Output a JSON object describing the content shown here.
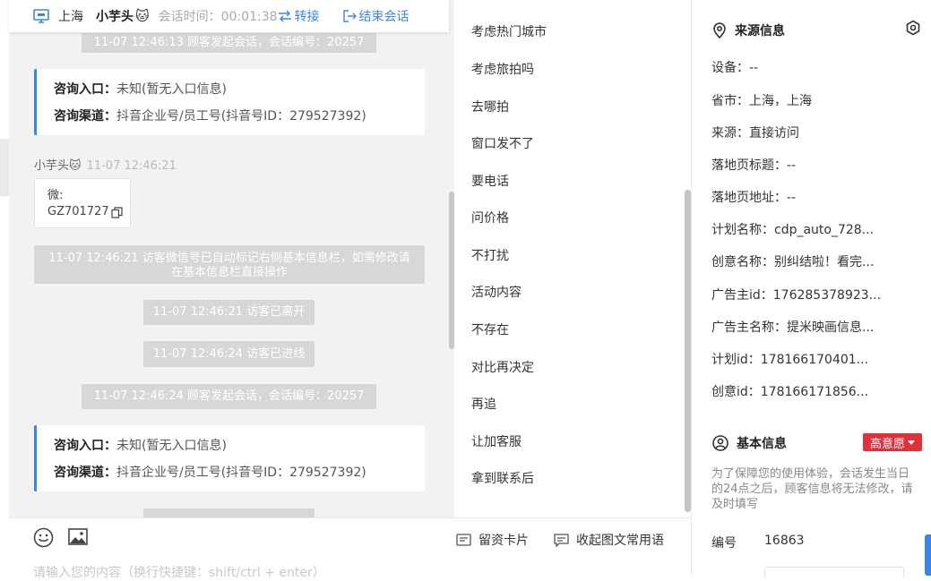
{
  "header": {
    "location": "上海",
    "visitor_name": "小芋头",
    "emoji": "🐱",
    "session_time": "会话时间：00:01:38",
    "transfer_label": "转接",
    "end_label": "结束会话"
  },
  "chat": {
    "sys1": "11-07 12:46:13 顾客发起会话，会话编号：20257",
    "card1": {
      "entry_key": "咨询入口：",
      "entry_val": "未知(暂无入口信息)",
      "channel_key": "咨询渠道：",
      "channel_val": "抖音企业号/员工号(抖音号ID：279527392)"
    },
    "msg_name": "小芋头",
    "msg_time": "11-07 12:46:21",
    "msg_line1": "微:",
    "msg_line2": "GZ701727",
    "sys2": "11-07 12:46:21 访客微信号已自动标记右侧基本信息栏，如需修改请在基本信息栏直接操作",
    "sys3": "11-07 12:46:21 访客已离开",
    "sys4": "11-07 12:46:24 访客已进线",
    "sys5": "11-07 12:46:24 顾客发起会话，会话编号：20257",
    "card2": {
      "entry_key": "咨询入口：",
      "entry_val": "未知(暂无入口信息)",
      "channel_key": "咨询渠道：",
      "channel_val": "抖音企业号/员工号(抖音号ID：279527392)"
    }
  },
  "input": {
    "placeholder": "请输入您的内容（换行快捷键：shift/ctrl + enter）",
    "leave_card": "留资卡片",
    "collapse_phrases": "收起图文常用语"
  },
  "phrases": [
    "考虑热门城市",
    "考虑旅拍吗",
    "去哪拍",
    "窗口发不了",
    "要电话",
    "问价格",
    "不打扰",
    "活动内容",
    "不存在",
    "对比再决定",
    "再追",
    "让加客服",
    "拿到联系后"
  ],
  "source": {
    "title": "来源信息",
    "rows": [
      "设备：--",
      "省市：上海，上海",
      "来源：直接访问",
      "落地页标题：--",
      "落地页地址：--",
      "计划名称：cdp_auto_728...",
      "创意名称：别纠结啦！看完...",
      "广告主id：176285378923...",
      "广告主名称：提米映画信息...",
      "计划id：178166170401...",
      "创意id：178166171856..."
    ]
  },
  "basic": {
    "title": "基本信息",
    "badge": "高意愿",
    "note": "为了保障您的使用体验，会话发生当日的24点之后，顾客信息将无法修改，请及时填写",
    "id_label": "编号",
    "id_value": "16863"
  },
  "colors": {
    "accent": "#3b86e0",
    "badge": "#e0303b"
  }
}
